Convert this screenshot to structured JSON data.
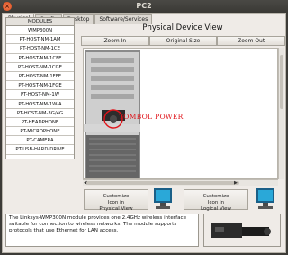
{
  "window": {
    "title": "PC2"
  },
  "tabs": [
    "Physical",
    "Config",
    "Desktop",
    "Software/Services"
  ],
  "modules": {
    "header": "MODULES",
    "items": [
      "WMP300N",
      "PT-HOST-NM-1AM",
      "PT-HOST-NM-1CE",
      "PT-HOST-NM-1CFE",
      "PT-HOST-NM-1CGE",
      "PT-HOST-NM-1FFE",
      "PT-HOST-NM-1FGE",
      "PT-HOST-NM-1W",
      "PT-HOST-NM-1W-A",
      "PT-HOST-NM-3G/4G",
      "PT-HEADPHONE",
      "PT-MICROPHONE",
      "PT-CAMERA",
      "PT-USB-HARD-DRIVE"
    ]
  },
  "physical_view": {
    "title": "Physical Device View",
    "zoom_in": "Zoom In",
    "original_size": "Original Size",
    "zoom_out": "Zoom Out",
    "annotation": "TOMBOL POWER"
  },
  "customize": {
    "physical_line1": "Customize",
    "physical_line2": "Icon in",
    "physical_line3": "Physical View",
    "logical_line1": "Customize",
    "logical_line2": "Icon in",
    "logical_line3": "Logical View"
  },
  "description": "The Linksys-WMP300N module provides one 2.4GHz wireless interface suitable for connection to wireless networks. The module supports protocols that use Ethernet for LAN access.",
  "colors": {
    "annotation_red": "#e0141a",
    "monitor_blue": "#2aa8d8"
  }
}
